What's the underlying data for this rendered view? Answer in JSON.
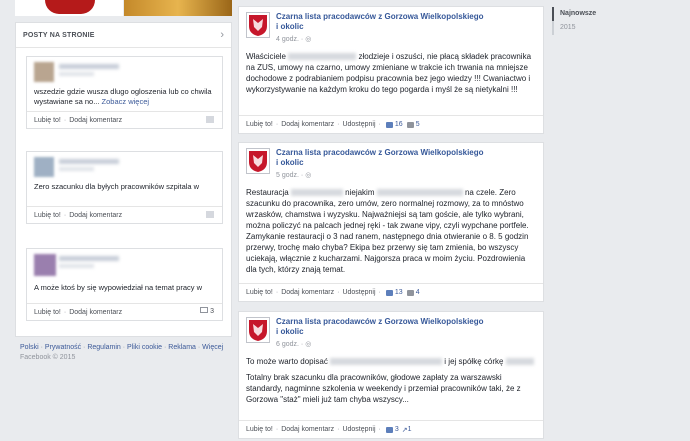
{
  "left_sidebar": {
    "header_title": "POSTY NA STRONIE",
    "posts": [
      {
        "text": "wszedzie gdzie wusza dlugo ogloszenia lub co chwila wystawiane sa no...",
        "see_more": "Zobacz więcej",
        "like_label": "Lubię to!",
        "comment_label": "Dodaj komentarz",
        "comment_count": ""
      },
      {
        "text": "Zero szacunku dla byłych pracowników szpitala w",
        "see_more": "",
        "like_label": "Lubię to!",
        "comment_label": "Dodaj komentarz",
        "comment_count": ""
      },
      {
        "text": "A może ktoś by się wypowiedział na temat pracy w",
        "see_more": "",
        "like_label": "Lubię to!",
        "comment_label": "Dodaj komentarz",
        "comment_count": "3"
      }
    ],
    "footer_links": [
      "Polski",
      "Prywatność",
      "Regulamin",
      "Pliki cookie",
      "Reklama",
      "Więcej"
    ],
    "copyright": "Facebook © 2015"
  },
  "feed": [
    {
      "page_name": "Czarna lista pracodawców z Gorzowa Wielkopolskiego i okolic",
      "time": "4 godz.",
      "text_prefix": "Właściciele",
      "text_body": "złodzieje i oszuści, nie płacą składek pracownika na ZUS, umowy na czarno, umowy zmieniane w trakcie ich trwania na mniejsze dochodowe z podrabianiem podpisu pracownia bez jego wiedzy !!! Cwaniactwo i wykorzystywanie na każdym kroku do tego pogarda i myśl że są nietykalni !!!",
      "like_label": "Lubię to!",
      "comment_label": "Dodaj komentarz",
      "share_label": "Udostępnij",
      "likes": "16",
      "comments": "5"
    },
    {
      "page_name": "Czarna lista pracodawców z Gorzowa Wielkopolskiego i okolic",
      "time": "5 godz.",
      "text_prefix": "Restauracja",
      "text_mid": "niejakim",
      "text_mid2": "na czele.",
      "text_body": "Zero szacunku do pracownika, zero umów, zero normalnej rozmowy, za to mnóstwo wrzasków, chamstwa i wyzysku. Najważniejsi są tam goście, ale tylko wybrani, można policzyć na palcach jednej ręki - tak zwane vipy, czyli wypchane portfele. Zamykanie restauracji o 3 nad ranem, następnego dnia otwieranie o 8. 5 godzin przerwy, trochę mało chyba? Ekipa bez przerwy się tam zmienia, bo wszyscy uciekają, włącznie z kucharzami. Najgorsza praca w moim życiu. Pozdrowienia dla tych, którzy znają temat.",
      "like_label": "Lubię to!",
      "comment_label": "Dodaj komentarz",
      "share_label": "Udostępnij",
      "likes": "13",
      "comments": "4"
    },
    {
      "page_name": "Czarna lista pracodawców z Gorzowa Wielkopolskiego i okolic",
      "time": "6 godz.",
      "text_prefix": "To może warto dopisać",
      "text_mid": "i jej spółkę córkę",
      "text_body": "Totalny brak szacunku dla pracowników, głodowe zapłaty za warszawski standardy, nagminne szkolenia w weekendy i przemiał pracowników taki, że z Gorzowa \"staż\" mieli już tam chyba wszyscy...",
      "like_label": "Lubię to!",
      "comment_label": "Dodaj komentarz",
      "share_label": "Udostępnij",
      "likes": "3",
      "shares": "1"
    }
  ],
  "timeline_nav": {
    "items": [
      "Najnowsze",
      "2015"
    ]
  }
}
